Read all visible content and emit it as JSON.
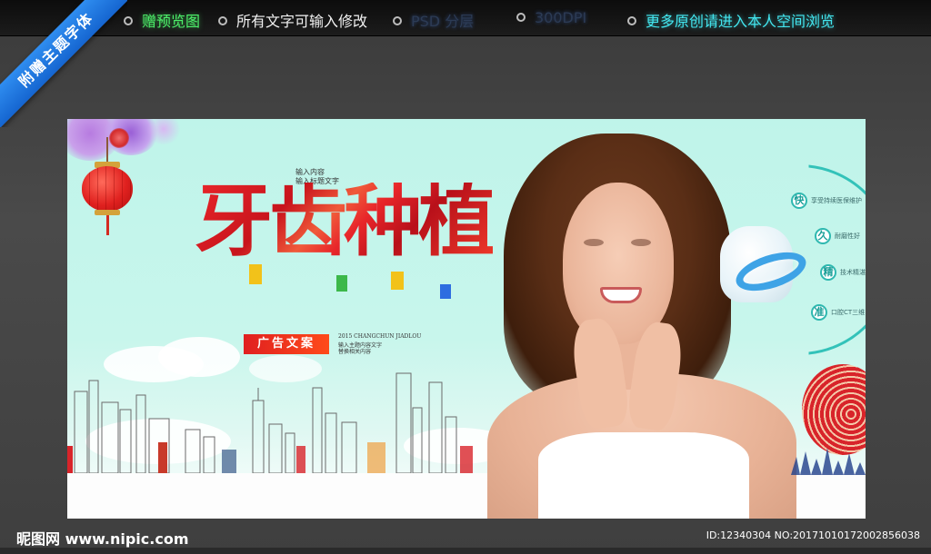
{
  "topbar": {
    "items": [
      {
        "label": "赠预览图",
        "style": "green"
      },
      {
        "label": "所有文字可输入修改",
        "style": "white"
      },
      {
        "label": "PSD 分层",
        "style": "dim"
      },
      {
        "label": "300DPI",
        "style": "dim"
      },
      {
        "label": "更多原创请进入本人空间浏览",
        "style": "cyan"
      }
    ]
  },
  "ribbon": {
    "label": "附赠主题字体",
    "color": "#1f78e0"
  },
  "poster": {
    "headline": "牙齿种植",
    "small_text_top": [
      "输入内容",
      "输入标题文字"
    ],
    "ad_label": "广告文案",
    "small_text_mid": "2015 CHANGCHUN JIADLOU",
    "small_text_bottom": [
      "输入主题内容文字",
      "替换相关内容"
    ],
    "features": [
      {
        "char": "快",
        "text": "享受持续医保维护"
      },
      {
        "char": "久",
        "text": "耐磨性好"
      },
      {
        "char": "精",
        "text": "技术精湛"
      },
      {
        "char": "准",
        "text": "口腔CT三维"
      }
    ],
    "colors": {
      "accent_red": "#e8262a",
      "teal": "#33c2b9",
      "background": "#c4f5eb"
    }
  },
  "footer": {
    "site": "昵图网 www.nipic.com",
    "id_text": "ID:12340304 NO:20171010172002856038"
  }
}
